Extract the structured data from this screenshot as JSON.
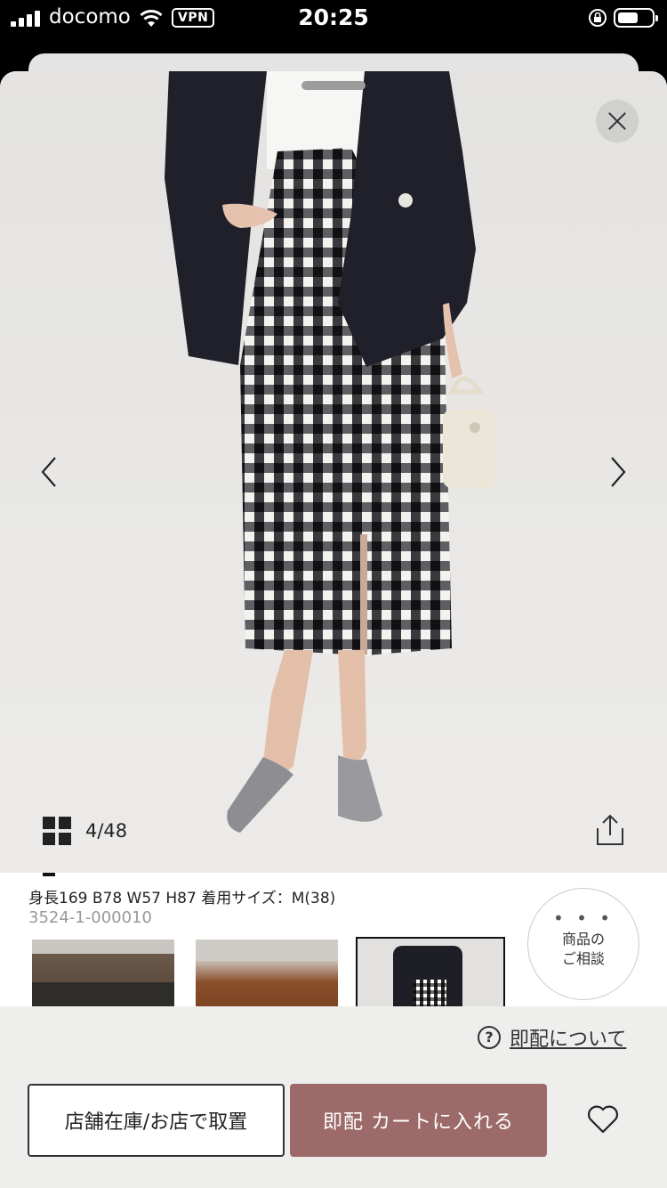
{
  "status_bar": {
    "carrier": "docomo",
    "vpn_label": "VPN",
    "time": "20:25"
  },
  "gallery": {
    "counter": "4/48"
  },
  "product": {
    "model_info": "身長169 B78 W57 H87 着用サイズ：M(38)",
    "code": "3524-1-000010"
  },
  "consult": {
    "dots": "• • •",
    "line1": "商品の",
    "line2": "ご相談"
  },
  "instant_delivery": {
    "help_icon": "?",
    "label": "即配について"
  },
  "actions": {
    "store_stock_label": "店舗在庫/お店で取置",
    "cart_label": "即配 カートに入れる"
  },
  "colors": {
    "cart_button": "#9c6a68",
    "bottom_bar": "#eeeeed"
  }
}
